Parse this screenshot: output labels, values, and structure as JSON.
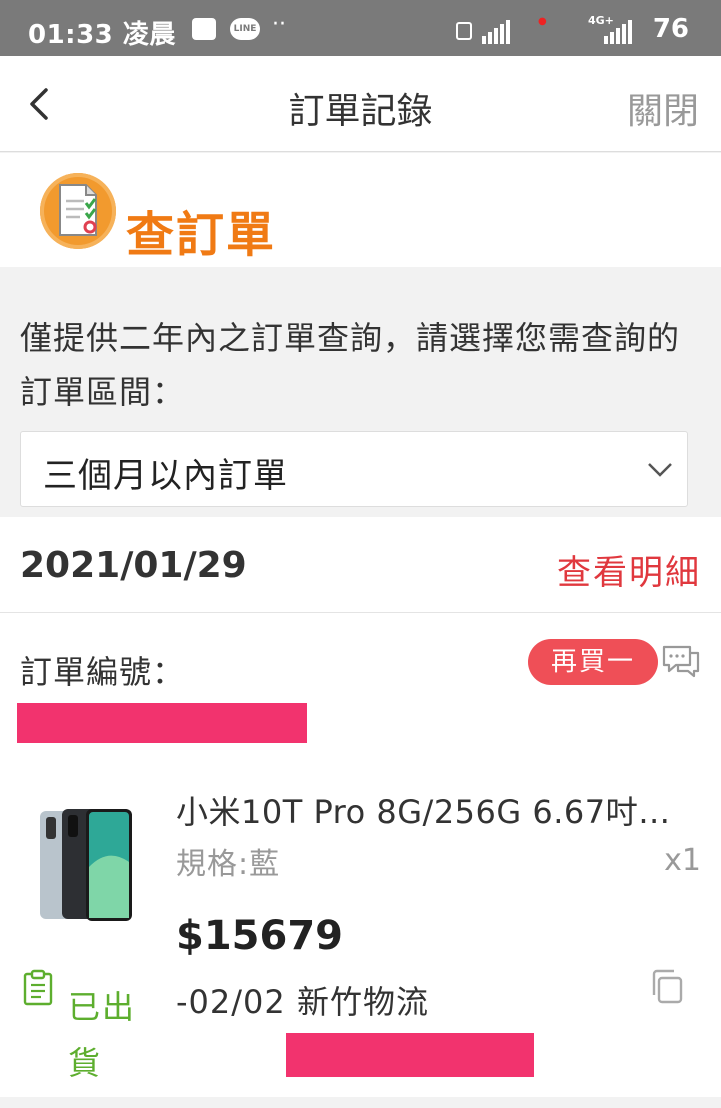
{
  "status_bar": {
    "time": "01:33 凌晨",
    "line_icon": "LINE",
    "dots": "··",
    "network_label": "4G+",
    "battery": "76",
    "icons": [
      "message-icon",
      "line-icon",
      "nfc-icon",
      "signal-icon",
      "signal-icon-2"
    ]
  },
  "nav": {
    "title": "訂單記錄",
    "close": "關閉",
    "back_icon": "chevron-left-icon"
  },
  "header": {
    "label": "查訂單",
    "icon": "order-document-icon"
  },
  "query": {
    "description": "僅提供二年內之訂單查詢，請選擇您需查詢的訂單區間：",
    "selected_range": "三個月以內訂單",
    "select_icon": "chevron-down-icon"
  },
  "order": {
    "date": "2021/01/29",
    "detail_link": "查看明細",
    "order_number_label": "訂單編號：",
    "rebuy_button": "再買一",
    "product": {
      "name": "小米10T Pro 8G/256G 6.67吋…",
      "spec": "規格:藍",
      "quantity": "x1",
      "price": "$15679"
    },
    "shipping": "-02/02 新竹物流",
    "status": "已出貨"
  },
  "colors": {
    "accent_orange": "#f07a14",
    "detail_red": "#e0383e",
    "rebuy_bg": "#ef4f57",
    "status_green": "#5dae2e",
    "redaction": "#f2336e"
  }
}
